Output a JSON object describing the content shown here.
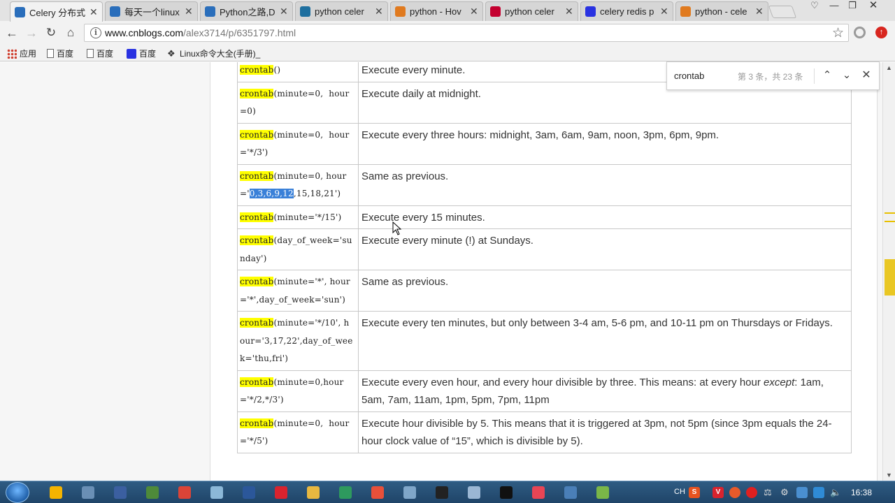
{
  "tabs": [
    {
      "label": "Celery 分布式",
      "icon": "cnblogs-icon",
      "color": "#2a6ebb",
      "active": true
    },
    {
      "label": "每天一个linux",
      "icon": "cnblogs-icon",
      "color": "#2a6ebb"
    },
    {
      "label": "Python之路,D",
      "icon": "cnblogs-icon",
      "color": "#2a6ebb"
    },
    {
      "label": "python celer",
      "icon": "bing-icon",
      "color": "#1e6f9f"
    },
    {
      "label": "python - Hov",
      "icon": "stackoverflow-icon",
      "color": "#e07a1f"
    },
    {
      "label": "python celer",
      "icon": "angular-icon",
      "color": "#c3002f"
    },
    {
      "label": "celery redis p",
      "icon": "baidu-paw-icon",
      "color": "#2932e1"
    },
    {
      "label": "python - cele",
      "icon": "stackoverflow-icon",
      "color": "#e07a1f"
    }
  ],
  "address": {
    "host": "www.cnblogs.com",
    "path": "/alex3714/p/6351797.html"
  },
  "bookmarks": [
    {
      "label": "应用",
      "icon": "apps-grid-icon"
    },
    {
      "label": "百度",
      "icon": "page-icon"
    },
    {
      "label": "百度",
      "icon": "page-icon"
    },
    {
      "label": "百度",
      "icon": "baidu-paw-icon"
    },
    {
      "label": "Linux命令大全(手册)_",
      "icon": "linux-icon"
    }
  ],
  "find": {
    "query": "crontab",
    "count": "第 3 条，共 23 条"
  },
  "table": {
    "rows": [
      {
        "code_hl": "crontab",
        "code_a": "()",
        "code_sel": "",
        "code_b": "",
        "desc": "Execute every minute."
      },
      {
        "code_hl": "crontab",
        "code_a": "(minute=0,  hour=0)",
        "code_sel": "",
        "code_b": "",
        "desc": "Execute daily at midnight."
      },
      {
        "code_hl": "crontab",
        "code_a": "(minute=0,  hour='*/3')",
        "code_sel": "",
        "code_b": "",
        "desc": "Execute every three hours: midnight, 3am, 6am, 9am, noon, 3pm, 6pm, 9pm."
      },
      {
        "code_hl": "crontab",
        "code_a": "(minute=0, hour='",
        "code_sel": "0,3,6,9,12",
        "code_b": ",15,18,21')",
        "desc": "Same as previous."
      },
      {
        "code_hl": "crontab",
        "code_a": "(minute='*/15')",
        "code_sel": "",
        "code_b": "",
        "desc": "Execute every 15 minutes."
      },
      {
        "code_hl": "crontab",
        "code_a": "(day_of_week='sunday')",
        "code_sel": "",
        "code_b": "",
        "desc": "Execute every minute (!) at Sundays."
      },
      {
        "code_hl": "crontab",
        "code_a": "(minute='*', hour='*',day_of_week='sun')",
        "code_sel": "",
        "code_b": "",
        "desc": "Same as previous."
      },
      {
        "code_hl": "crontab",
        "code_a": "(minute='*/10', hour='3,17,22',day_of_week='thu,fri')",
        "code_sel": "",
        "code_b": "",
        "desc": "Execute every ten minutes, but only between 3-4 am, 5-6 pm, and 10-11 pm on Thursdays or Fridays."
      },
      {
        "code_hl": "crontab",
        "code_a": "(minute=0,hour='*/2,*/3')",
        "code_sel": "",
        "code_b": "",
        "desc": "Execute every even hour, and every hour divisible by three. This means: at every hour except: 1am, 5am, 7am, 11am, 1pm, 5pm, 7pm, 11pm"
      },
      {
        "code_hl": "crontab",
        "code_a": "(minute=0,  hour='*/5')",
        "code_sel": "",
        "code_b": "",
        "desc": "Execute hour divisible by 5. This means that it is triggered at 3pm, not 5pm (since 3pm equals the 24-hour clock value of “15”, which is divisible by 5)."
      }
    ]
  },
  "taskbar": {
    "apps": [
      {
        "icon": "qq-icon",
        "color": "#f5b400"
      },
      {
        "icon": "tools-icon",
        "color": "#6a8fb5"
      },
      {
        "icon": "save-disk-icon",
        "color": "#3b5fa0"
      },
      {
        "icon": "puzzle-icon",
        "color": "#4e8a3a"
      },
      {
        "icon": "chrome-icon",
        "color": "#db4437"
      },
      {
        "icon": "notepad-icon",
        "color": "#8cb8d8"
      },
      {
        "icon": "word-icon",
        "color": "#2b579a"
      },
      {
        "icon": "red-app-icon",
        "color": "#d9232e"
      },
      {
        "icon": "folder-icon",
        "color": "#e8b840"
      },
      {
        "icon": "green-app-icon",
        "color": "#2e9a5e"
      },
      {
        "icon": "paint-icon",
        "color": "#e8503a"
      },
      {
        "icon": "network-icon",
        "color": "#7fa6c9"
      },
      {
        "icon": "terminal-icon",
        "color": "#222222"
      },
      {
        "icon": "window-icon",
        "color": "#9bb7d4"
      },
      {
        "icon": "pycharm-icon",
        "color": "#111111"
      },
      {
        "icon": "pocket-icon",
        "color": "#e84555"
      },
      {
        "icon": "remote-desktop-icon",
        "color": "#4a7fb8"
      },
      {
        "icon": "feather-icon",
        "color": "#7ab648"
      }
    ],
    "lang": "CH",
    "time": "16:38"
  }
}
